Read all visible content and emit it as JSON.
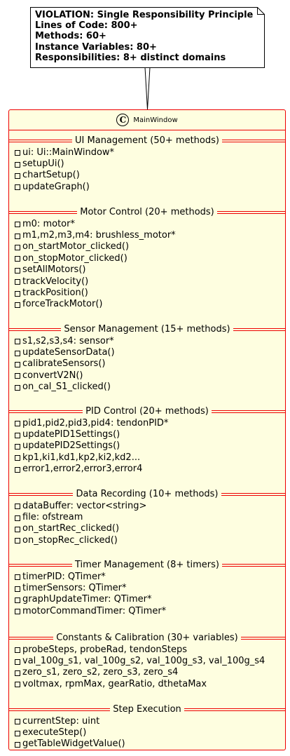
{
  "note": {
    "lines": [
      "VIOLATION: Single Responsibility Principle",
      "Lines of Code: 800+",
      "Methods: 60+",
      "Instance Variables: 80+",
      "Responsibilities: 8+ distinct domains"
    ]
  },
  "class": {
    "stereotype_icon": "C",
    "name": "MainWindow",
    "colors": {
      "border": "#e00000",
      "fill": "#fefee0"
    },
    "sections": [
      {
        "title": "UI Management (50+ methods)",
        "items": [
          "ui: Ui::MainWindow*",
          "setupUi()",
          "chartSetup()",
          "updateGraph()"
        ]
      },
      {
        "title": "Motor Control (20+ methods)",
        "items": [
          "m0: motor*",
          "m1,m2,m3,m4: brushless_motor*",
          "on_startMotor_clicked()",
          "on_stopMotor_clicked()",
          "setAllMotors()",
          "trackVelocity()",
          "trackPosition()",
          "forceTrackMotor()"
        ]
      },
      {
        "title": "Sensor Management (15+ methods)",
        "items": [
          "s1,s2,s3,s4: sensor*",
          "updateSensorData()",
          "calibrateSensors()",
          "convertV2N()",
          "on_cal_S1_clicked()"
        ]
      },
      {
        "title": "PID Control (20+ methods)",
        "items": [
          "pid1,pid2,pid3,pid4: tendonPID*",
          "updatePID1Settings()",
          "updatePID2Settings()",
          "kp1,ki1,kd1,kp2,ki2,kd2...",
          "error1,error2,error3,error4"
        ]
      },
      {
        "title": "Data Recording (10+ methods)",
        "items": [
          "dataBuffer: vector<string>",
          "file: ofstream",
          "on_startRec_clicked()",
          "on_stopRec_clicked()"
        ]
      },
      {
        "title": "Timer Management (8+ timers)",
        "items": [
          "timerPID: QTimer*",
          "timerSensors: QTimer*",
          "graphUpdateTimer: QTimer*",
          "motorCommandTimer: QTimer*"
        ]
      },
      {
        "title": "Constants & Calibration (30+ variables)",
        "items": [
          "probeSteps, probeRad, tendonSteps",
          "val_100g_s1, val_100g_s2, val_100g_s3, val_100g_s4",
          "zero_s1, zero_s2, zero_s3, zero_s4",
          "voltmax, rpmMax, gearRatio, dthetaMax"
        ]
      },
      {
        "title": "Step Execution",
        "items": [
          "currentStep: uint",
          "executeStep()",
          "getTableWidgetValue()"
        ]
      }
    ]
  }
}
